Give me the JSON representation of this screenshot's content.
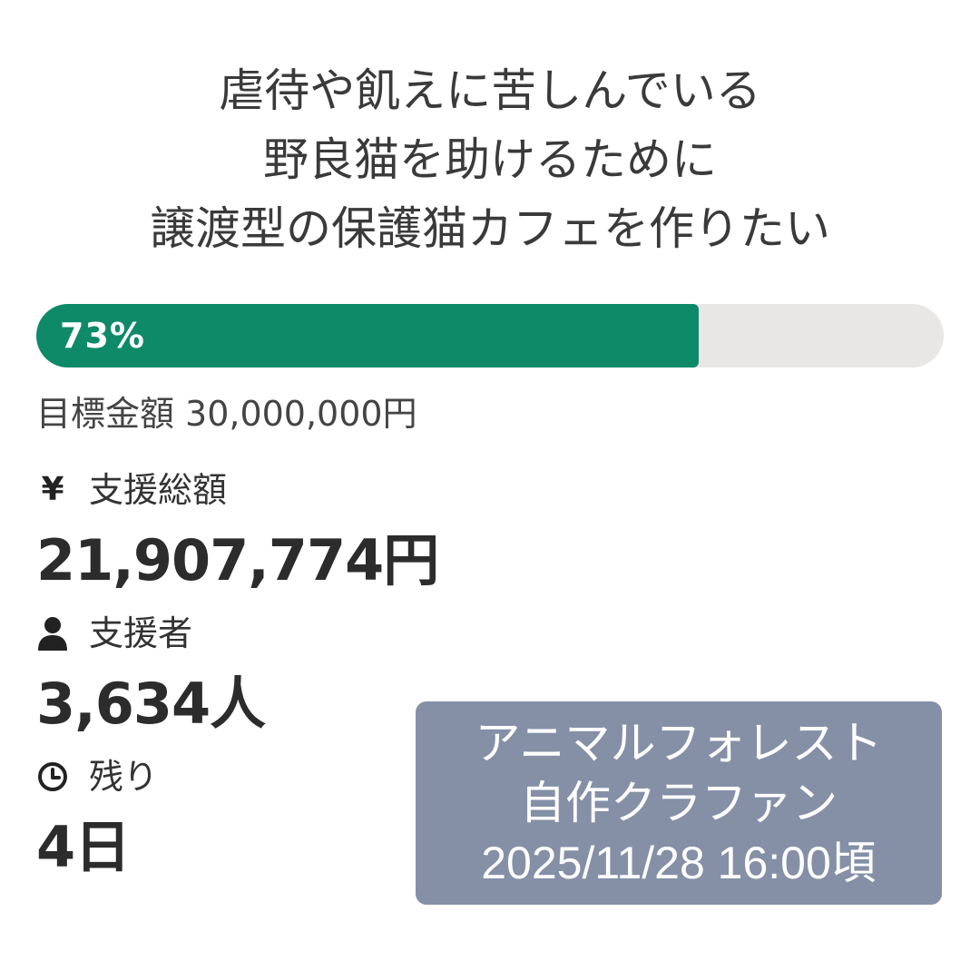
{
  "project": {
    "title_lines": [
      "虐待や飢えに苦しんでいる",
      "野良猫を助けるために",
      "譲渡型の保護猫カフェを作りたい"
    ]
  },
  "progress": {
    "percent_label": "73%",
    "fraction": 0.73,
    "fill_color": "#0e8a68",
    "track_color": "#e9e6e6"
  },
  "goal": {
    "label": "目標金額",
    "amount": "30,000,000円"
  },
  "stats": {
    "total": {
      "icon": "yen-icon",
      "icon_glyph": "¥",
      "label": "支援総額",
      "value": "21,907,774円"
    },
    "supporters": {
      "icon": "person-icon",
      "label": "支援者",
      "value": "3,634人"
    },
    "remaining": {
      "icon": "clock-icon",
      "label": "残り",
      "value": "4日"
    }
  },
  "overlay": {
    "lines": [
      "アニマルフォレスト",
      "自作クラファン",
      "2025/11/28 16:00頃"
    ],
    "background_color": "#8590a7"
  }
}
